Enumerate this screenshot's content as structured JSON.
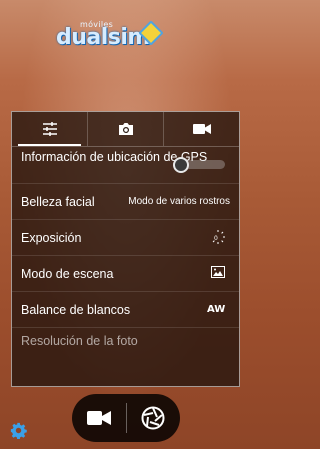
{
  "watermark": {
    "small_text": "móviles",
    "brand_text": "dualsim"
  },
  "settings_panel": {
    "tabs": [
      {
        "name": "general-settings",
        "icon": "sliders-icon",
        "active": true
      },
      {
        "name": "photo-settings",
        "icon": "camera-icon",
        "active": false
      },
      {
        "name": "video-settings",
        "icon": "video-camera-icon",
        "active": false
      }
    ],
    "rows": [
      {
        "label": "Información de ubicación de GPS",
        "control": "toggle",
        "toggle_on": false
      },
      {
        "label": "Belleza facial",
        "value": "Modo de varios rostros"
      },
      {
        "label": "Exposición",
        "icon": "exposure-icon",
        "icon_text": "0"
      },
      {
        "label": "Modo de escena",
        "icon": "scene-icon"
      },
      {
        "label": "Balance de blancos",
        "icon": "white-balance-auto-icon",
        "icon_text": "AW"
      }
    ],
    "partial_row_label": "Resolución de la foto"
  },
  "camera_controls": {
    "video_icon": "video-camera-icon",
    "shutter_icon": "shutter-aperture-icon"
  },
  "settings_gear_icon": "gear-icon",
  "colors": {
    "panel_bg": "#23140e",
    "accent": "#3aa0e8",
    "gear": "#3aa0e8"
  }
}
